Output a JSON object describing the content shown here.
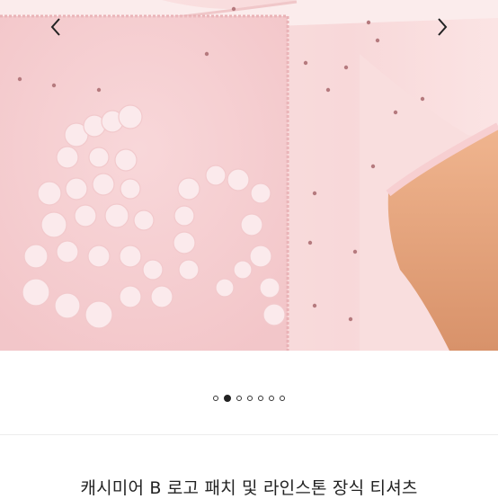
{
  "carousel": {
    "image_alt": "Pink cashmere t-shirt with B logo patch and rhinestones",
    "prev_icon": "chevron-left-icon",
    "next_icon": "chevron-right-icon",
    "total_slides": 7,
    "active_slide": 2
  },
  "product": {
    "title": "캐시미어 B 로고 패치 및 라인스톤 장식 티셔츠"
  },
  "colors": {
    "shirt": "#f8d7d8",
    "patch": "#f4c3c6",
    "boucle": "#fbe8ea",
    "skin": "#e8a77e",
    "rhinestone": "#b57a7e"
  }
}
